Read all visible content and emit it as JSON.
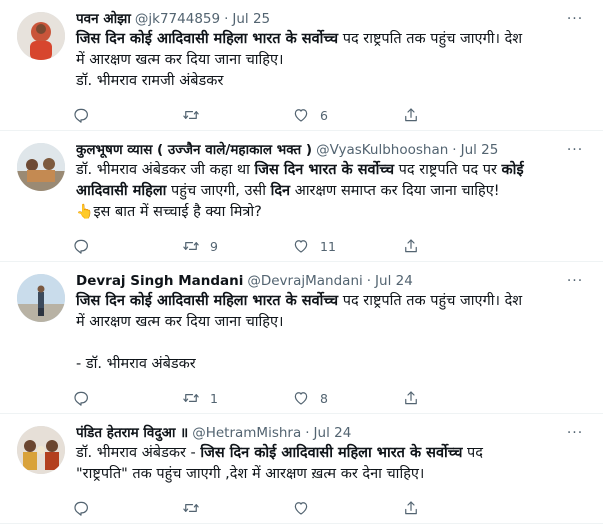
{
  "tweets": [
    {
      "name": "पवन ओझा",
      "handle": "@jk7744859",
      "time": "Jul 25",
      "lines": [
        [
          {
            "t": "जिस दिन कोई आदिवासी महिला भारत के सर्वोच्च",
            "b": true
          },
          {
            "t": " पद राष्ट्रपति तक पहुंच जाएगी। देश"
          }
        ],
        [
          {
            "t": "में आरक्षण खत्म कर दिया जाना चाहिए।"
          }
        ],
        [
          {
            "t": "डॉ. भीमराव रामजी अंबेडकर"
          }
        ]
      ],
      "reply": "",
      "retweet": "",
      "like": "6"
    },
    {
      "name": "कुलभूषण व्यास ( उज्जैन वाले/महाकाल भक्त )",
      "handle": "@VyasKulbhooshan",
      "time": "Jul 25",
      "lines": [
        [
          {
            "t": "डॉ. भीमराव अंबेडकर जी कहा था "
          },
          {
            "t": "जिस दिन भारत के सर्वोच्च",
            "b": true
          },
          {
            "t": " पद राष्ट्रपति पद पर "
          },
          {
            "t": "कोई",
            "b": true
          }
        ],
        [
          {
            "t": "आदिवासी महिला",
            "b": true
          },
          {
            "t": " पहुंच जाएगी, उसी "
          },
          {
            "t": "दिन",
            "b": true
          },
          {
            "t": " आरक्षण समाप्त कर दिया जाना चाहिए!"
          }
        ],
        [
          {
            "t": "👆",
            "e": true
          },
          {
            "t": "इस बात में सच्चाई है क्या मित्रो?"
          }
        ]
      ],
      "reply": "",
      "retweet": "9",
      "like": "11"
    },
    {
      "name": "Devraj Singh Mandani",
      "handle": "@DevrajMandani",
      "time": "Jul 24",
      "lines": [
        [
          {
            "t": "जिस दिन कोई आदिवासी महिला भारत के सर्वोच्च",
            "b": true
          },
          {
            "t": " पद राष्ट्रपति तक पहुंच जाएगी। देश"
          }
        ],
        [
          {
            "t": "में आरक्षण खत्म कर दिया जाना चाहिए।"
          }
        ],
        [
          {
            "t": " "
          }
        ],
        [
          {
            "t": "- डॉ. भीमराव अंबेडकर"
          }
        ]
      ],
      "reply": "",
      "retweet": "1",
      "like": "8"
    },
    {
      "name": "पंडित हेतराम विदुआ ॥",
      "handle": "@HetramMishra",
      "time": "Jul 24",
      "lines": [
        [
          {
            "t": "डॉ. भीमराव अंबेडकर - "
          },
          {
            "t": "जिस दिन कोई आदिवासी महिला भारत के सर्वोच्च",
            "b": true
          },
          {
            "t": " पद"
          }
        ],
        [
          {
            "t": "\"राष्ट्रपति\" तक पहुंच जाएगी ,देश में आरक्षण ख़त्म कर देना चाहिए।"
          }
        ]
      ],
      "reply": "",
      "retweet": "",
      "like": ""
    }
  ],
  "icons": {
    "more": "more-dots-icon",
    "reply": "reply-icon",
    "retweet": "retweet-icon",
    "like": "heart-icon",
    "share": "share-icon"
  },
  "colors": {
    "text": "#0f1419",
    "muted": "#536471",
    "divider": "#eff3f4"
  }
}
